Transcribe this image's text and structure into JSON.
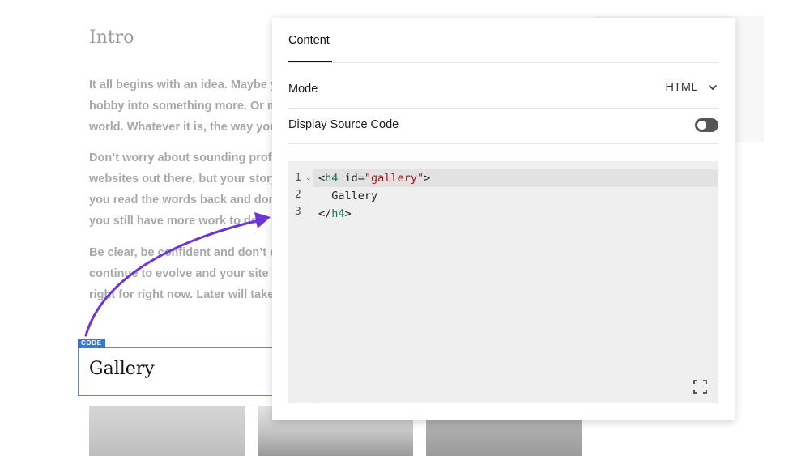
{
  "page": {
    "intro_title": "Intro",
    "paragraphs": [
      "It all begins with an idea. Maybe y\nhobby into something more. Or m\nworld. Whatever it is, the way you",
      "Don’t worry about sounding profe\nwebsites out there, but your story\nyou read the words back and don\nyou still have more work to do.",
      "Be clear, be confident and don’t o\ncontinue to evolve and your site c\nright for right now. Later will take"
    ],
    "code_block_tag": "CODE",
    "gallery_heading": "Gallery"
  },
  "panel": {
    "tab_label": "Content",
    "mode_label": "Mode",
    "mode_value": "HTML",
    "source_label": "Display Source Code",
    "source_toggle_on": false,
    "editor": {
      "line_numbers": [
        "1",
        "2",
        "3"
      ],
      "lines": [
        {
          "open": "<",
          "tag": "h4",
          "attr": " id=",
          "value": "\"gallery\"",
          "close": ">"
        },
        {
          "text": "  Gallery"
        },
        {
          "open": "</",
          "tag": "h4",
          "close": ">"
        }
      ]
    }
  },
  "colors": {
    "accent_blue": "#2f7ad4",
    "arrow_purple": "#6a35d9",
    "tag_green": "#117a46",
    "string_red": "#a31515"
  },
  "icons": [
    "chevron-down-icon",
    "fold-chevron-icon",
    "expand-icon",
    "arrow-annotation"
  ]
}
